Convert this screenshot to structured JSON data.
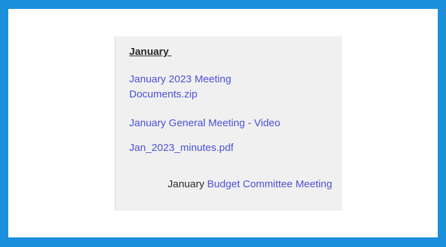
{
  "section": {
    "heading": "January ",
    "links": [
      {
        "label": "January 2023 Meeting Documents.zip"
      },
      {
        "label": "January General Meeting - Video"
      },
      {
        "label": "Jan_2023_minutes.pdf"
      }
    ],
    "budget_item": {
      "prefix": "January ",
      "link_label": "Budget Committee Meeting"
    }
  },
  "colors": {
    "frame_border": "#1a8fdc",
    "link": "#4a50d8",
    "panel_background": "#f0f0f0"
  }
}
